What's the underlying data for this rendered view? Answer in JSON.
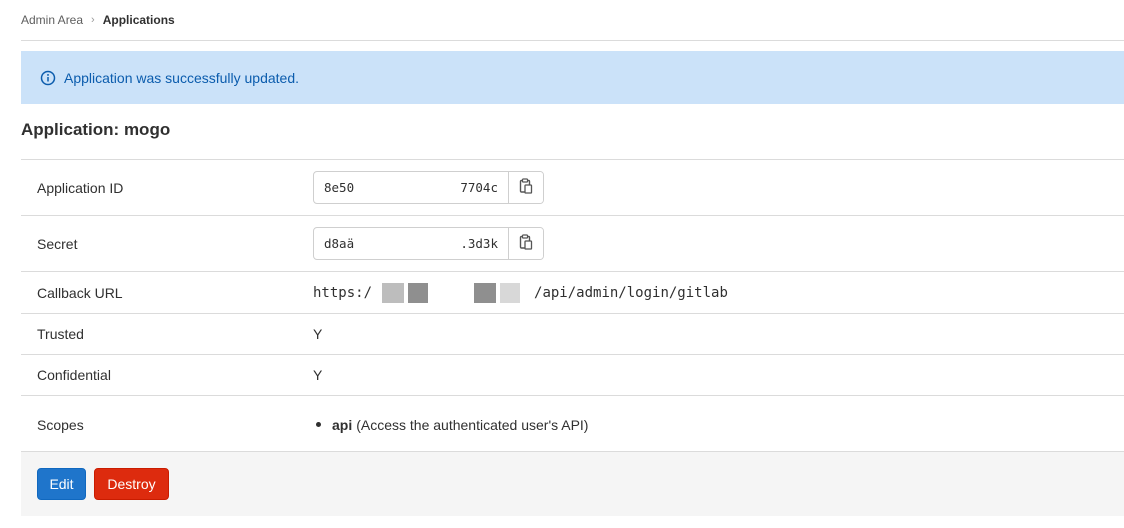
{
  "breadcrumb": {
    "parent": "Admin Area",
    "current": "Applications"
  },
  "flash": {
    "message": "Application was successfully updated.",
    "icon": "info-icon",
    "color": "#0b5cad",
    "background": "#cbe2f9"
  },
  "page": {
    "title": "Application: mogo"
  },
  "details": {
    "application_id": {
      "label": "Application ID",
      "value_start": "8e50\u0001",
      "value_end": "7704c",
      "copy_icon": "clipboard-icon"
    },
    "secret": {
      "label": "Secret",
      "value_start": "d8aä",
      "value_end": ".3d3k",
      "copy_icon": "clipboard-icon"
    },
    "callback_url": {
      "label": "Callback URL",
      "value_start": "https:/",
      "value_end": "/api/admin/login/gitlab"
    },
    "trusted": {
      "label": "Trusted",
      "value": "Y"
    },
    "confidential": {
      "label": "Confidential",
      "value": "Y"
    },
    "scopes": {
      "label": "Scopes",
      "items": [
        {
          "name": "api",
          "description": "(Access the authenticated user's API)"
        }
      ]
    }
  },
  "actions": {
    "edit_label": "Edit",
    "destroy_label": "Destroy",
    "edit_color": "#1f75cb",
    "destroy_color": "#dd2b0e"
  }
}
